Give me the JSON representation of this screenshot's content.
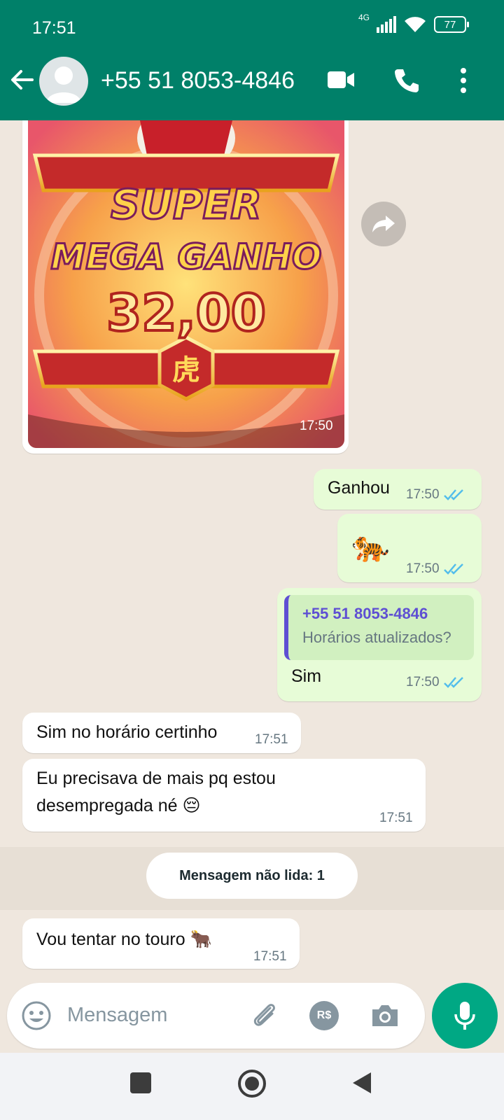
{
  "status_bar": {
    "time": "17:51",
    "network": "4G",
    "battery": "77"
  },
  "header": {
    "contact": "+55 51 8053-4846"
  },
  "messages": {
    "image_time": "17:50",
    "image_caption": {
      "line1": "SUPER",
      "line2": "MEGA GANHO",
      "value": "32,00",
      "glyph": "虎"
    },
    "m1": {
      "text": "Ganhou",
      "time": "17:50"
    },
    "m2": {
      "emoji": "🐅",
      "time": "17:50"
    },
    "m3": {
      "quote_name": "+55 51 8053-4846",
      "quote_text": "Horários atualizados?",
      "text": "Sim",
      "time": "17:50"
    },
    "m4": {
      "text": "Sim no horário certinho",
      "time": "17:51"
    },
    "m5": {
      "line1": "Eu precisava de mais pq estou",
      "line2": "desempregada né 😔",
      "time": "17:51"
    },
    "unread": "Mensagem não lida: 1",
    "m6": {
      "text": "Vou tentar no touro 🐂",
      "time": "17:51"
    }
  },
  "input": {
    "placeholder": "Mensagem",
    "currency_label": "R$"
  },
  "colors": {
    "header": "#008069",
    "outgoing": "#e7fcd7",
    "tick_blue": "#53bdeb",
    "mic": "#00a884"
  }
}
